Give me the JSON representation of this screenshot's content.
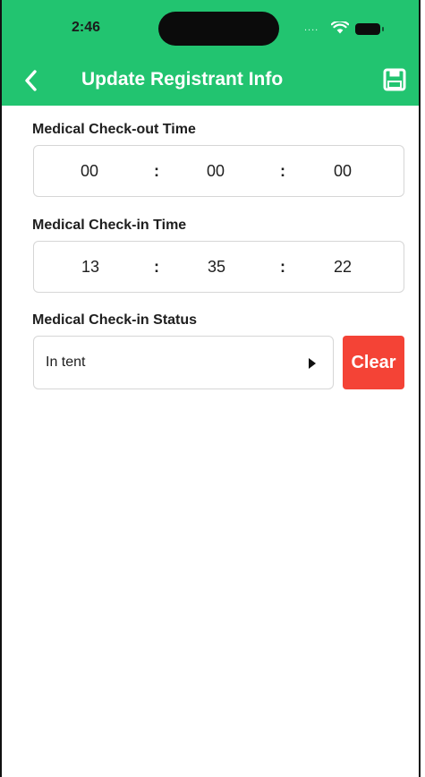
{
  "status_bar": {
    "time": "2:46",
    "signal": "....",
    "wifi_icon": "wifi-icon",
    "battery_icon": "battery-icon"
  },
  "header": {
    "title": "Update Registrant Info",
    "back_icon": "chevron-left-icon",
    "save_icon": "floppy-disk-icon",
    "background_color": "#22c470"
  },
  "form": {
    "checkout": {
      "label": "Medical Check-out Time",
      "hours": "00",
      "minutes": "00",
      "seconds": "00",
      "separator": ":"
    },
    "checkin": {
      "label": "Medical Check-in Time",
      "hours": "13",
      "minutes": "35",
      "seconds": "22",
      "separator": ":"
    },
    "status": {
      "label": "Medical Check-in Status",
      "value": "In tent",
      "caret_icon": "caret-right-icon",
      "clear_label": "Clear",
      "clear_color": "#f44336"
    }
  }
}
